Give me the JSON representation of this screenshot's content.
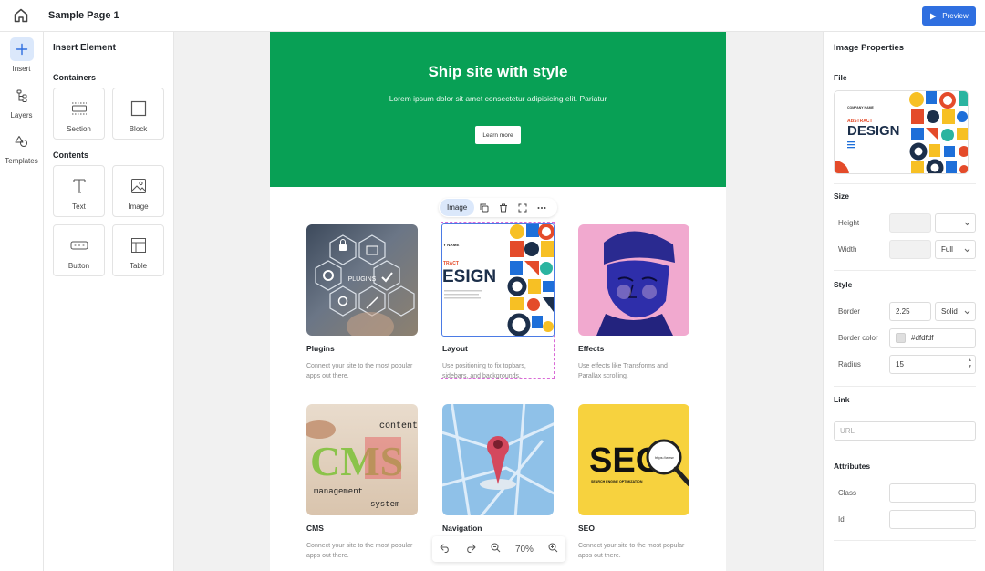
{
  "topbar": {
    "page_name": "Sample Page 1",
    "preview_label": "Preview"
  },
  "rail": {
    "items": [
      {
        "label": "Insert"
      },
      {
        "label": "Layers"
      },
      {
        "label": "Templates"
      }
    ]
  },
  "insert_panel": {
    "title": "Insert Element",
    "containers_label": "Containers",
    "contents_label": "Contents",
    "containers": [
      {
        "label": "Section"
      },
      {
        "label": "Block"
      }
    ],
    "contents": [
      {
        "label": "Text"
      },
      {
        "label": "Image"
      },
      {
        "label": "Button"
      },
      {
        "label": "Table"
      }
    ]
  },
  "hero": {
    "title": "Ship site with style",
    "subtitle": "Lorem ipsum dolor sit amet consectetur adipisicing elit. Pariatur",
    "button": "Learn more"
  },
  "element_toolbar": {
    "selected_type": "Image"
  },
  "cards": [
    {
      "title": "Plugins",
      "desc": "Connect your site to the most popular apps out there.",
      "thumb_text": "PLUGINS"
    },
    {
      "title": "Layout",
      "desc": "Use positioning to fix topbars, sidebars, and backgrounds.",
      "thumb_text": "ESIGN",
      "thumb_small": "TRACT",
      "thumb_top": "Y NAME"
    },
    {
      "title": "Effects",
      "desc": "Use effects like Transforms and Parallax scrolling."
    },
    {
      "title": "CMS",
      "desc": "Connect your site to the most popular apps out there.",
      "thumb_text": "CMS",
      "thumb_word1": "content",
      "thumb_word2": "management",
      "thumb_word3": "system"
    },
    {
      "title": "Navigation",
      "desc": ""
    },
    {
      "title": "SEO",
      "desc": "Connect your site to the most popular apps out there.",
      "thumb_text": "SEO",
      "thumb_small": "SEARCH ENGINE OPTIMIZATION",
      "thumb_url": "https://www"
    }
  ],
  "zoom": {
    "level": "70%"
  },
  "props": {
    "title": "Image Properties",
    "file_label": "File",
    "file_preview": {
      "company": "COMPANY NAME",
      "abstract": "ABSTRACT",
      "design": "DESIGN"
    },
    "size_label": "Size",
    "height_label": "Height",
    "width_label": "Width",
    "width_unit": "Full",
    "style_label": "Style",
    "border_label": "Border",
    "border_value": "2.25",
    "border_style": "Solid",
    "border_color_label": "Border color",
    "border_color_value": "#dfdfdf",
    "radius_label": "Radius",
    "radius_value": "15",
    "link_label": "Link",
    "url_placeholder": "URL",
    "attributes_label": "Attributes",
    "class_label": "Class",
    "id_label": "Id"
  },
  "colors": {
    "accent": "#2f6fe0",
    "hero_green": "#08a055",
    "selection": "#4b7be5"
  }
}
